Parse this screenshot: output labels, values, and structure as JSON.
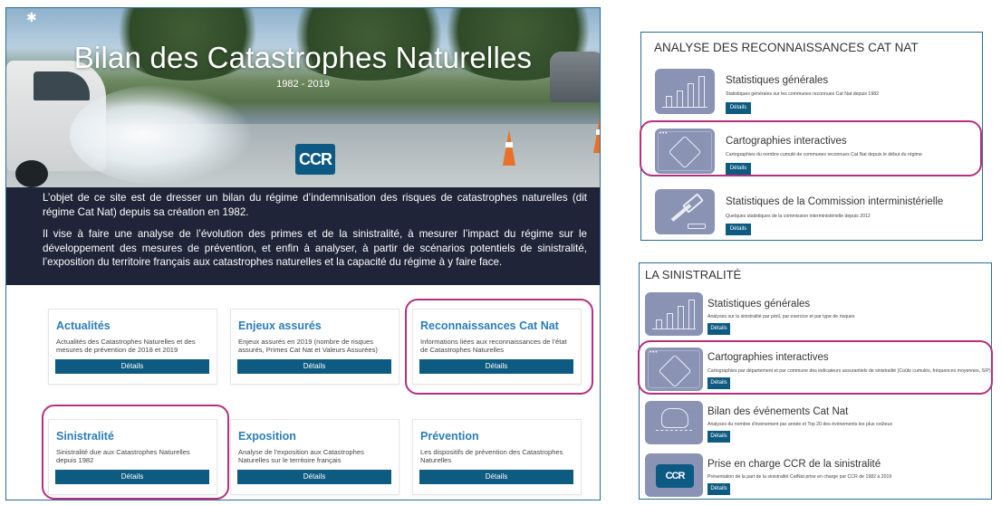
{
  "site": {
    "title": "Bilan des Catastrophes Naturelles",
    "years": "1982 - 2019",
    "logo_text": "CCR",
    "intro_paragraphs": [
      "L’objet de ce site est de dresser un bilan du régime d’indemnisation des risques de catastrophes naturelles (dit régime Cat Nat) depuis sa création en 1982.",
      "Il vise à faire une analyse de l’évolution des primes et de la sinistralité, à mesurer l’impact du régime sur le développement des mesures de prévention, et enfin à analyser, à partir de scénarios potentiels de sinistralité, l’exposition du territoire français aux catastrophes naturelles et la capacité du régime à y faire face."
    ],
    "cards": [
      {
        "title": "Actualités",
        "desc": "Actualités des Catastrophes Naturelles et des mesures de prévention de 2018 et 2019",
        "button": "Détails"
      },
      {
        "title": "Enjeux assurés",
        "desc": "Enjeux assurés en 2019 (nombre de risques assurés, Primes Cat Nat et Valeurs Assurées)",
        "button": "Détails"
      },
      {
        "title": "Reconnaissances Cat Nat",
        "desc": "Informations liées aux reconnaissances de l’état de Catastrophes Naturelles",
        "button": "Détails"
      },
      {
        "title": "Sinistralité",
        "desc": "Sinistralité due aux Catastrophes Naturelles depuis 1982",
        "button": "Détails"
      },
      {
        "title": "Exposition",
        "desc": "Analyse de l’exposition aux Catastrophes Naturelles sur le territoire français",
        "button": "Détails"
      },
      {
        "title": "Prévention",
        "desc": "Les dispositifs de prévention des Catastrophes Naturelles",
        "button": "Détails"
      }
    ]
  },
  "panel_recon": {
    "title": "ANALYSE DES RECONNAISSANCES CAT NAT",
    "rows": [
      {
        "icon": "bar-chart-icon",
        "title": "Statistiques générales",
        "desc": "Statistiques générales sur les communes reconnues Cat Nat depuis 1982",
        "button": "Détails"
      },
      {
        "icon": "france-map-icon",
        "title": "Cartographies interactives",
        "desc": "Cartographies du nombre cumulé de communes reconnues Cat Nat depuis le début du régime",
        "button": "Détails"
      },
      {
        "icon": "gavel-icon",
        "title": "Statistiques de la Commission interministérielle",
        "desc": "Quelques statistiques de la commission interministérielle depuis 2012",
        "button": "Détails"
      }
    ]
  },
  "panel_sinistralite": {
    "title": "LA SINISTRALITÉ",
    "rows": [
      {
        "icon": "bar-chart-icon",
        "title": "Statistiques générales",
        "desc": "Analyses sur la sinistralité par péril, par exercice et par type de risques",
        "button": "Détails"
      },
      {
        "icon": "france-map-icon",
        "title": "Cartographies interactives",
        "desc": "Cartographies par département et par commune des indicateurs assurantiels de sinistralité (Coûts cumulés, fréquences moyennes, S/P)",
        "button": "Détails"
      },
      {
        "icon": "storm-icon",
        "title": "Bilan des événements Cat Nat",
        "desc": "Analyses du nombre d’événement par année et Top 20 des événements les plus coûteux",
        "button": "Détails"
      },
      {
        "icon": "ccr-logo-icon",
        "title": "Prise en charge CCR de la sinistralité",
        "desc": "Présentation de la part de la sinistralité CatNat prise en charge par CCR de 1982 à 2019",
        "button": "Détails",
        "icon_text": "CCR"
      }
    ]
  },
  "colors": {
    "accent": "#0e5b82",
    "card_title": "#2c7db7",
    "highlight": "#b5307f",
    "intro_bg": "#1f2438",
    "icon_bg": "#8b93b4"
  }
}
